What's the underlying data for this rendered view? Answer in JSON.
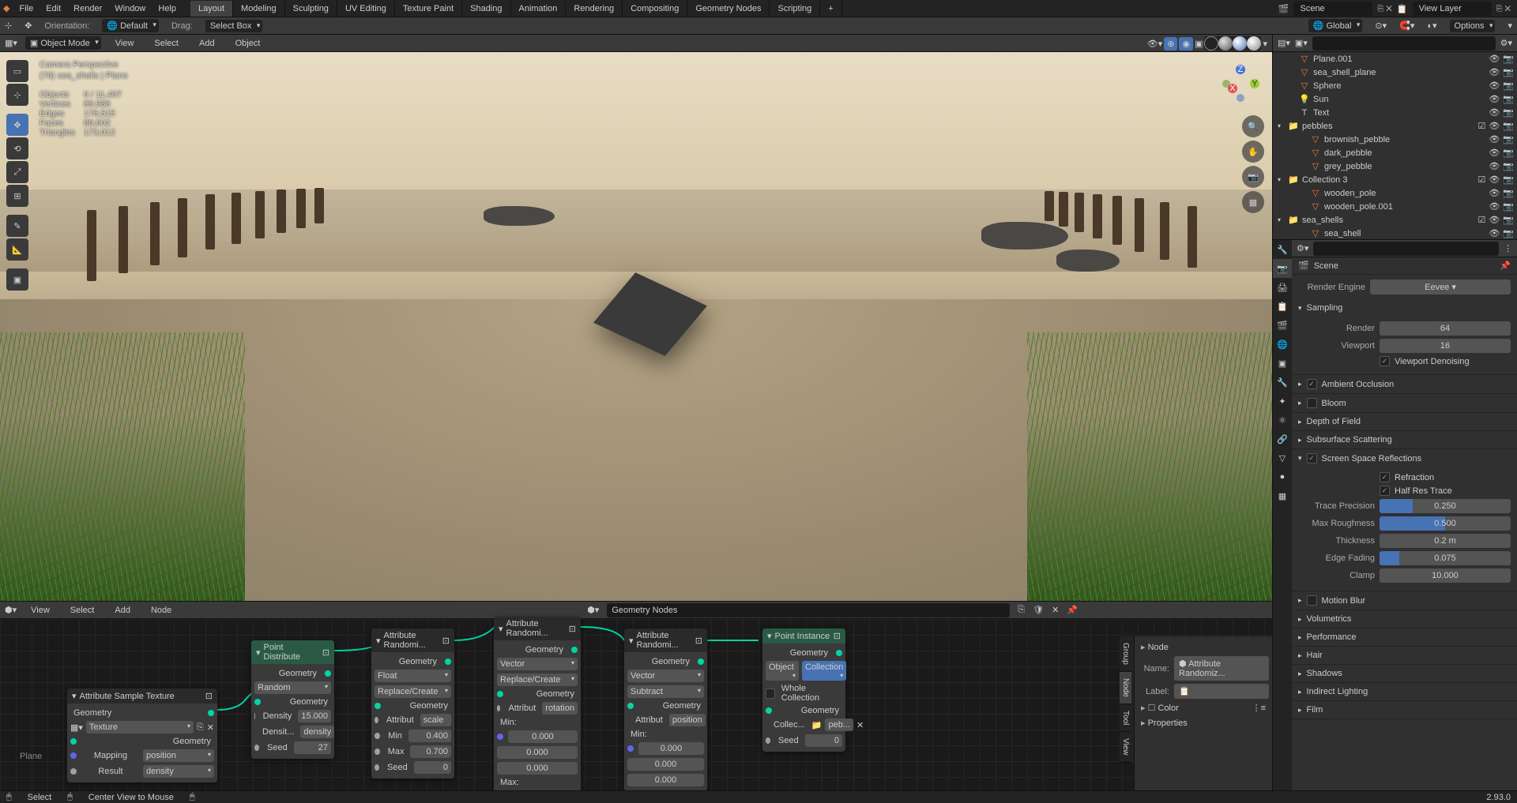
{
  "topmenu": [
    "File",
    "Edit",
    "Render",
    "Window",
    "Help"
  ],
  "workspaces": [
    "Layout",
    "Modeling",
    "Sculpting",
    "UV Editing",
    "Texture Paint",
    "Shading",
    "Animation",
    "Rendering",
    "Compositing",
    "Geometry Nodes",
    "Scripting"
  ],
  "top_right": {
    "scene": "Scene",
    "layer": "View Layer"
  },
  "toolbar": {
    "orientation_lbl": "Orientation:",
    "orientation": "Default",
    "drag_lbl": "Drag:",
    "drag": "Select Box",
    "pivot": "Global",
    "options": "Options"
  },
  "viewport_header": {
    "mode": "Object Mode",
    "menus": [
      "View",
      "Select",
      "Add",
      "Object"
    ]
  },
  "overlay": {
    "view": "Camera Perspective",
    "obj": "(78) sea_shells | Plane",
    "stats": {
      "Objects": "0 / 11,407",
      "Vertices": "89,986",
      "Edges": "176,515",
      "Faces": "86,602",
      "Triangles": "173,012"
    }
  },
  "outliner": {
    "search_ph": "",
    "items": [
      {
        "indent": 1,
        "icon": "mesh",
        "name": "Plane.001",
        "ctrl": [
          "👁",
          "📷"
        ]
      },
      {
        "indent": 1,
        "icon": "mesh",
        "name": "sea_shell_plane",
        "ctrl": [
          "👁",
          "📷"
        ]
      },
      {
        "indent": 1,
        "icon": "mesh",
        "name": "Sphere",
        "ctrl": [
          "👁",
          "📷"
        ]
      },
      {
        "indent": 1,
        "icon": "light",
        "name": "Sun",
        "ctrl": [
          "👁",
          "📷"
        ]
      },
      {
        "indent": 1,
        "icon": "text",
        "name": "Text",
        "ctrl": [
          "👁",
          "📷"
        ]
      },
      {
        "indent": 0,
        "icon": "coll",
        "name": "pebbles",
        "ctrl": [
          "☑",
          "👁",
          "📷"
        ]
      },
      {
        "indent": 2,
        "icon": "mesh",
        "name": "brownish_pebble",
        "ctrl": [
          "👁",
          "📷"
        ]
      },
      {
        "indent": 2,
        "icon": "mesh",
        "name": "dark_pebble",
        "ctrl": [
          "👁",
          "📷"
        ]
      },
      {
        "indent": 2,
        "icon": "mesh",
        "name": "grey_pebble",
        "ctrl": [
          "👁",
          "📷"
        ]
      },
      {
        "indent": 0,
        "icon": "coll",
        "name": "Collection 3",
        "ctrl": [
          "☑",
          "👁",
          "📷"
        ]
      },
      {
        "indent": 2,
        "icon": "mesh",
        "name": "wooden_pole",
        "ctrl": [
          "👁",
          "📷"
        ]
      },
      {
        "indent": 2,
        "icon": "mesh",
        "name": "wooden_pole.001",
        "ctrl": [
          "👁",
          "📷"
        ]
      },
      {
        "indent": 0,
        "icon": "coll",
        "name": "sea_shells",
        "ctrl": [
          "☑",
          "👁",
          "📷"
        ]
      },
      {
        "indent": 2,
        "icon": "mesh",
        "name": "sea_shell",
        "ctrl": [
          "👁",
          "📷"
        ]
      }
    ]
  },
  "properties": {
    "scene": "Scene",
    "engine_lbl": "Render Engine",
    "engine": "Eevee",
    "sampling": "Sampling",
    "render_lbl": "Render",
    "render": "64",
    "viewport_lbl": "Viewport",
    "viewport": "16",
    "denoise": "Viewport Denoising",
    "ao": "Ambient Occlusion",
    "bloom": "Bloom",
    "dof": "Depth of Field",
    "sss": "Subsurface Scattering",
    "ssr": "Screen Space Reflections",
    "refraction": "Refraction",
    "halfres": "Half Res Trace",
    "trace_lbl": "Trace Precision",
    "trace": "0.250",
    "rough_lbl": "Max Roughness",
    "rough": "0.500",
    "thick_lbl": "Thickness",
    "thick": "0.2 m",
    "fade_lbl": "Edge Fading",
    "fade": "0.075",
    "clamp_lbl": "Clamp",
    "clamp": "10.000",
    "closed": [
      "Motion Blur",
      "Volumetrics",
      "Performance",
      "Hair",
      "Shadows",
      "Indirect Lighting",
      "Film"
    ]
  },
  "node_editor": {
    "menus": [
      "View",
      "Select",
      "Add",
      "Node"
    ],
    "name": "Geometry Nodes",
    "nodes": {
      "samptex": {
        "title": "Attribute Sample Texture",
        "out": "Geometry",
        "in": [
          "Geometry",
          "Mapping",
          "Result"
        ],
        "tex": "Texture",
        "map": "position",
        "res": "density"
      },
      "dist": {
        "title": "Point Distribute",
        "out": "Geometry",
        "mode": "Random",
        "in": "Geometry",
        "density_lbl": "Density",
        "density": "15.000",
        "densattr_lbl": "Densit...",
        "densattr": "density",
        "seed_lbl": "Seed",
        "seed": "27"
      },
      "rnd1": {
        "title": "Attribute Randomi...",
        "out": "Geometry",
        "type": "Float",
        "op": "Replace/Create",
        "in": "Geometry",
        "attr_lbl": "Attribut",
        "attr": "scale",
        "min_lbl": "Min",
        "min": "0.400",
        "max_lbl": "Max",
        "max": "0.700",
        "seed_lbl": "Seed",
        "seed": "0"
      },
      "rnd2": {
        "title": "Attribute Randomi...",
        "out": "Geometry",
        "type": "Vector",
        "op": "Replace/Create",
        "in": "Geometry",
        "attr_lbl": "Attribut",
        "attr": "rotation",
        "min_lbl": "Min:",
        "v1": "0.000",
        "v2": "0.000",
        "v3": "0.000",
        "max_lbl": "Max:"
      },
      "rnd3": {
        "title": "Attribute Randomi...",
        "out": "Geometry",
        "type": "Vector",
        "op": "Subtract",
        "in": "Geometry",
        "attr_lbl": "Attribut",
        "attr": "position",
        "min_lbl": "Min:",
        "v1": "0.000",
        "v2": "0.000",
        "v3": "0.000"
      },
      "inst": {
        "title": "Point Instance",
        "out": "Geometry",
        "mode1": "Object",
        "mode2": "Collection",
        "whole": "Whole Collection",
        "in": "Geometry",
        "coll_lbl": "Collec...",
        "coll": "peb...",
        "seed_lbl": "Seed",
        "seed": "0"
      },
      "plane": "Plane"
    },
    "sidebar": {
      "node": "Node",
      "name_lbl": "Name:",
      "name": "Attribute Randomiz...",
      "label_lbl": "Label:",
      "color": "Color",
      "props": "Properties"
    }
  },
  "statusbar": {
    "select": "Select",
    "center": "Center View to Mouse",
    "ver": "2.93.0"
  }
}
